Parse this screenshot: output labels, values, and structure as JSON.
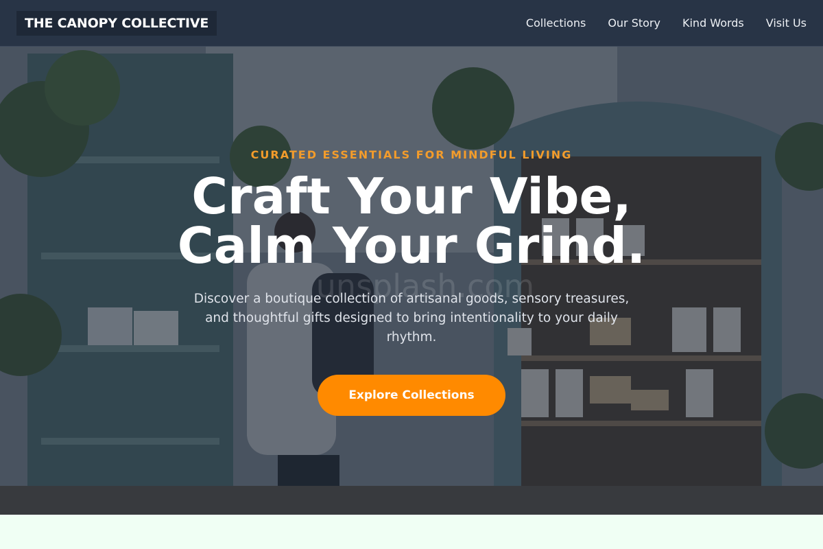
{
  "header": {
    "logo": "THE CANOPY COLLECTIVE",
    "nav": [
      "Collections",
      "Our Story",
      "Kind Words",
      "Visit Us"
    ]
  },
  "hero": {
    "eyebrow": "CURATED ESSENTIALS FOR MINDFUL LIVING",
    "headline_line1": "Craft Your Vibe,",
    "headline_line2": "Calm Your Grind.",
    "subtext": "Discover a boutique collection of artisanal goods, sensory treasures, and thoughtful gifts designed to bring intentionality to your daily rhythm.",
    "cta_label": "Explore Collections",
    "watermark": "unsplash.com",
    "background_image": "shop-interior-photo"
  },
  "colors": {
    "header_bg": "#283446",
    "accent": "#ff8a00",
    "eyebrow": "#f39c2b",
    "page_bg": "#f0fff4"
  }
}
